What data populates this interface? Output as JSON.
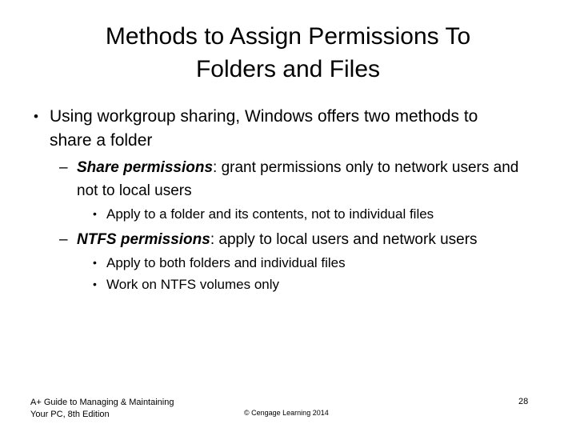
{
  "slide": {
    "title": "Methods to Assign Permissions To Folders and Files",
    "title_line1": "Methods to Assign Permissions To",
    "title_line2": "Folders and Files",
    "background_color": "#ffffff",
    "text_color": "#000000",
    "bullet_glyphs": {
      "level1": "•",
      "level2": "–",
      "level3": "•"
    },
    "content": [
      {
        "level": 1,
        "text": "Using workgroup sharing, Windows offers two methods to share a folder"
      },
      {
        "level": 2,
        "emphasis": "Share permissions",
        "rest": ": grant permissions only to network users and not to local users"
      },
      {
        "level": 3,
        "text": "Apply to a folder and its contents, not to individual files"
      },
      {
        "level": 2,
        "emphasis": "NTFS permissions",
        "rest": ": apply to local users and network users"
      },
      {
        "level": 3,
        "text": "Apply to both folders and individual files"
      },
      {
        "level": 3,
        "text": "Work on NTFS volumes only"
      }
    ]
  },
  "footer": {
    "book_line1": "A+ Guide to Managing & Maintaining",
    "book_line2": "Your PC, 8th Edition",
    "copyright": "© Cengage Learning 2014",
    "page_number": "28"
  }
}
